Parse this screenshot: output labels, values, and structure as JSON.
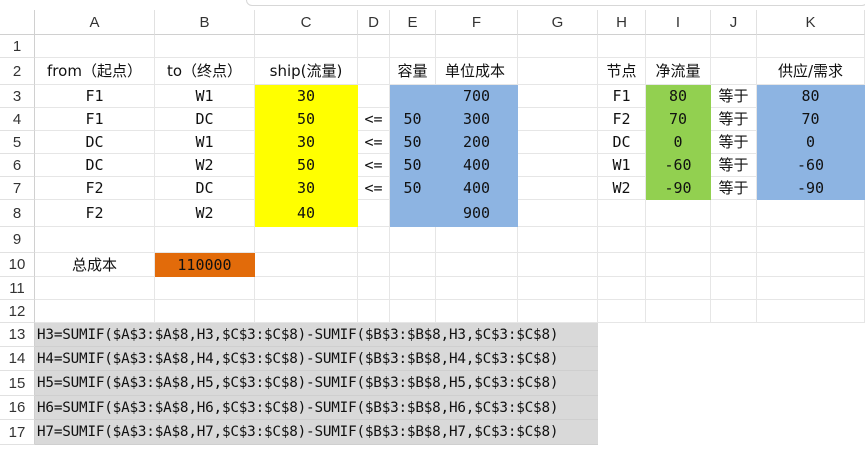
{
  "columns": [
    "A",
    "B",
    "C",
    "D",
    "E",
    "F",
    "G",
    "H",
    "I",
    "J",
    "K"
  ],
  "rows": [
    "1",
    "2",
    "3",
    "4",
    "5",
    "6",
    "7",
    "8",
    "9",
    "10",
    "11",
    "12",
    "13",
    "14",
    "15",
    "16",
    "17"
  ],
  "headers": {
    "from": "from（起点）",
    "to": "to（终点）",
    "ship": "ship(流量)",
    "capacity": "容量",
    "unit_cost": "单位成本",
    "node": "节点",
    "net_flow": "净流量",
    "supply_demand": "供应/需求"
  },
  "arcs": [
    {
      "from": "F1",
      "to": "W1",
      "ship": "30",
      "le": "",
      "cap": "",
      "cost": "700"
    },
    {
      "from": "F1",
      "to": "DC",
      "ship": "50",
      "le": "<=",
      "cap": "50",
      "cost": "300"
    },
    {
      "from": "DC",
      "to": "W1",
      "ship": "30",
      "le": "<=",
      "cap": "50",
      "cost": "200"
    },
    {
      "from": "DC",
      "to": "W2",
      "ship": "50",
      "le": "<=",
      "cap": "50",
      "cost": "400"
    },
    {
      "from": "F2",
      "to": "DC",
      "ship": "30",
      "le": "<=",
      "cap": "50",
      "cost": "400"
    },
    {
      "from": "F2",
      "to": "W2",
      "ship": "40",
      "le": "",
      "cap": "",
      "cost": "900"
    }
  ],
  "nodes": [
    {
      "node": "F1",
      "net": "80",
      "eq": "等于",
      "sd": "80"
    },
    {
      "node": "F2",
      "net": "70",
      "eq": "等于",
      "sd": "70"
    },
    {
      "node": "DC",
      "net": "0",
      "eq": "等于",
      "sd": "0"
    },
    {
      "node": "W1",
      "net": "-60",
      "eq": "等于",
      "sd": "-60"
    },
    {
      "node": "W2",
      "net": "-90",
      "eq": "等于",
      "sd": "-90"
    }
  ],
  "total_cost_label": "总成本",
  "total_cost_value": "110000",
  "formulas": [
    "H3=SUMIF($A$3:$A$8,H3,$C$3:$C$8)-SUMIF($B$3:$B$8,H3,$C$3:$C$8)",
    "H4=SUMIF($A$3:$A$8,H4,$C$3:$C$8)-SUMIF($B$3:$B$8,H4,$C$3:$C$8)",
    "H5=SUMIF($A$3:$A$8,H5,$C$3:$C$8)-SUMIF($B$3:$B$8,H5,$C$3:$C$8)",
    "H6=SUMIF($A$3:$A$8,H6,$C$3:$C$8)-SUMIF($B$3:$B$8,H6,$C$3:$C$8)",
    "H7=SUMIF($A$3:$A$8,H7,$C$3:$C$8)-SUMIF($B$3:$B$8,H7,$C$3:$C$8)"
  ],
  "colors": {
    "ship": "#ffff00",
    "cost": "#8db4e2",
    "net": "#92d050",
    "total": "#e26b0a",
    "formula_bg": "#d9d9d9"
  }
}
